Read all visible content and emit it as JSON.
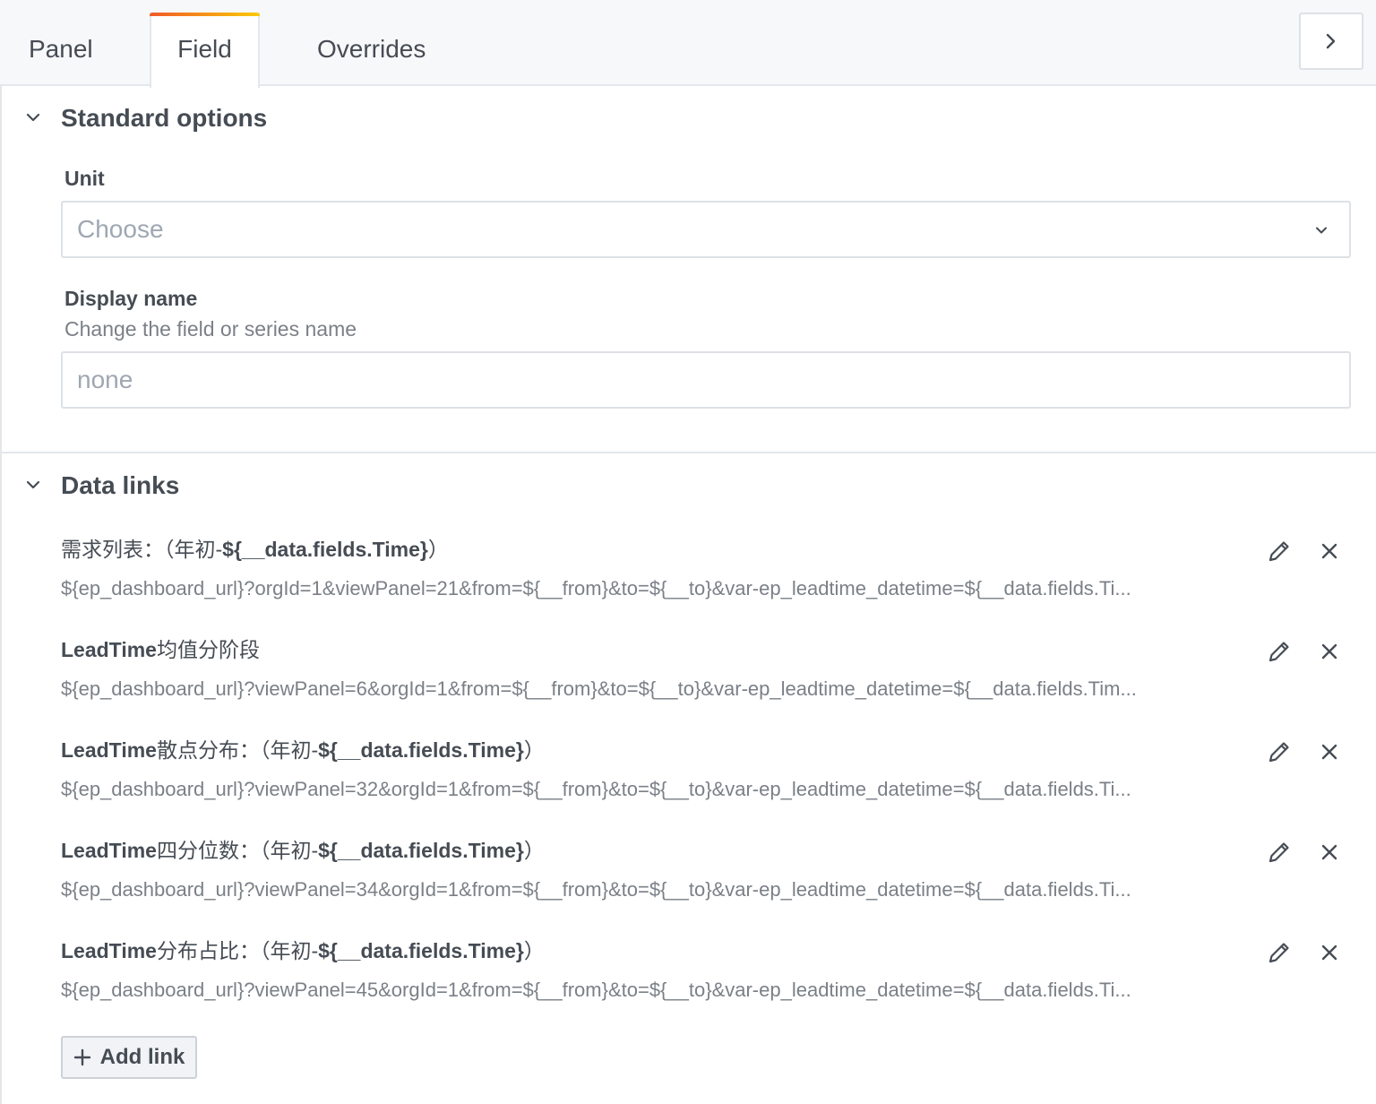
{
  "tabs": [
    {
      "label": "Panel",
      "active": false
    },
    {
      "label": "Field",
      "active": true
    },
    {
      "label": "Overrides",
      "active": false
    }
  ],
  "collapse_icon": "chevron-right-icon",
  "standard_options": {
    "title": "Standard options",
    "unit": {
      "label": "Unit",
      "placeholder": "Choose"
    },
    "display_name": {
      "label": "Display name",
      "description": "Change the field or series name",
      "placeholder": "none"
    }
  },
  "data_links": {
    "title": "Data links",
    "links": [
      {
        "title_prefix": "需求列表：（年初-",
        "title_bold": "${__data.fields.Time}",
        "title_suffix": "）",
        "url": "${ep_dashboard_url}?orgId=1&viewPanel=21&from=${__from}&to=${__to}&var-ep_leadtime_datetime=${__data.fields.Ti..."
      },
      {
        "title_prefix": "",
        "title_bold": "LeadTime",
        "title_suffix": "均值分阶段",
        "url": "${ep_dashboard_url}?viewPanel=6&orgId=1&from=${__from}&to=${__to}&var-ep_leadtime_datetime=${__data.fields.Tim..."
      },
      {
        "title_prefix": "",
        "title_bold": "LeadTime",
        "title_suffix": "散点分布：（年初-",
        "title_bold2": "${__data.fields.Time}",
        "title_suffix2": "）",
        "url": "${ep_dashboard_url}?viewPanel=32&orgId=1&from=${__from}&to=${__to}&var-ep_leadtime_datetime=${__data.fields.Ti..."
      },
      {
        "title_prefix": "",
        "title_bold": "LeadTime",
        "title_suffix": "四分位数：（年初-",
        "title_bold2": "${__data.fields.Time}",
        "title_suffix2": "）",
        "url": "${ep_dashboard_url}?viewPanel=34&orgId=1&from=${__from}&to=${__to}&var-ep_leadtime_datetime=${__data.fields.Ti..."
      },
      {
        "title_prefix": "",
        "title_bold": "LeadTime",
        "title_suffix": "分布占比：（年初-",
        "title_bold2": "${__data.fields.Time}",
        "title_suffix2": "）",
        "url": "${ep_dashboard_url}?viewPanel=45&orgId=1&from=${__from}&to=${__to}&var-ep_leadtime_datetime=${__data.fields.Ti..."
      }
    ],
    "add_link_label": "Add link"
  },
  "colors": {
    "text": "#464c54",
    "muted": "#7b8087",
    "placeholder": "#9fa7b3",
    "border": "#dde1e6",
    "tab_accent_start": "#f05a28",
    "tab_accent_end": "#fbca0a"
  }
}
